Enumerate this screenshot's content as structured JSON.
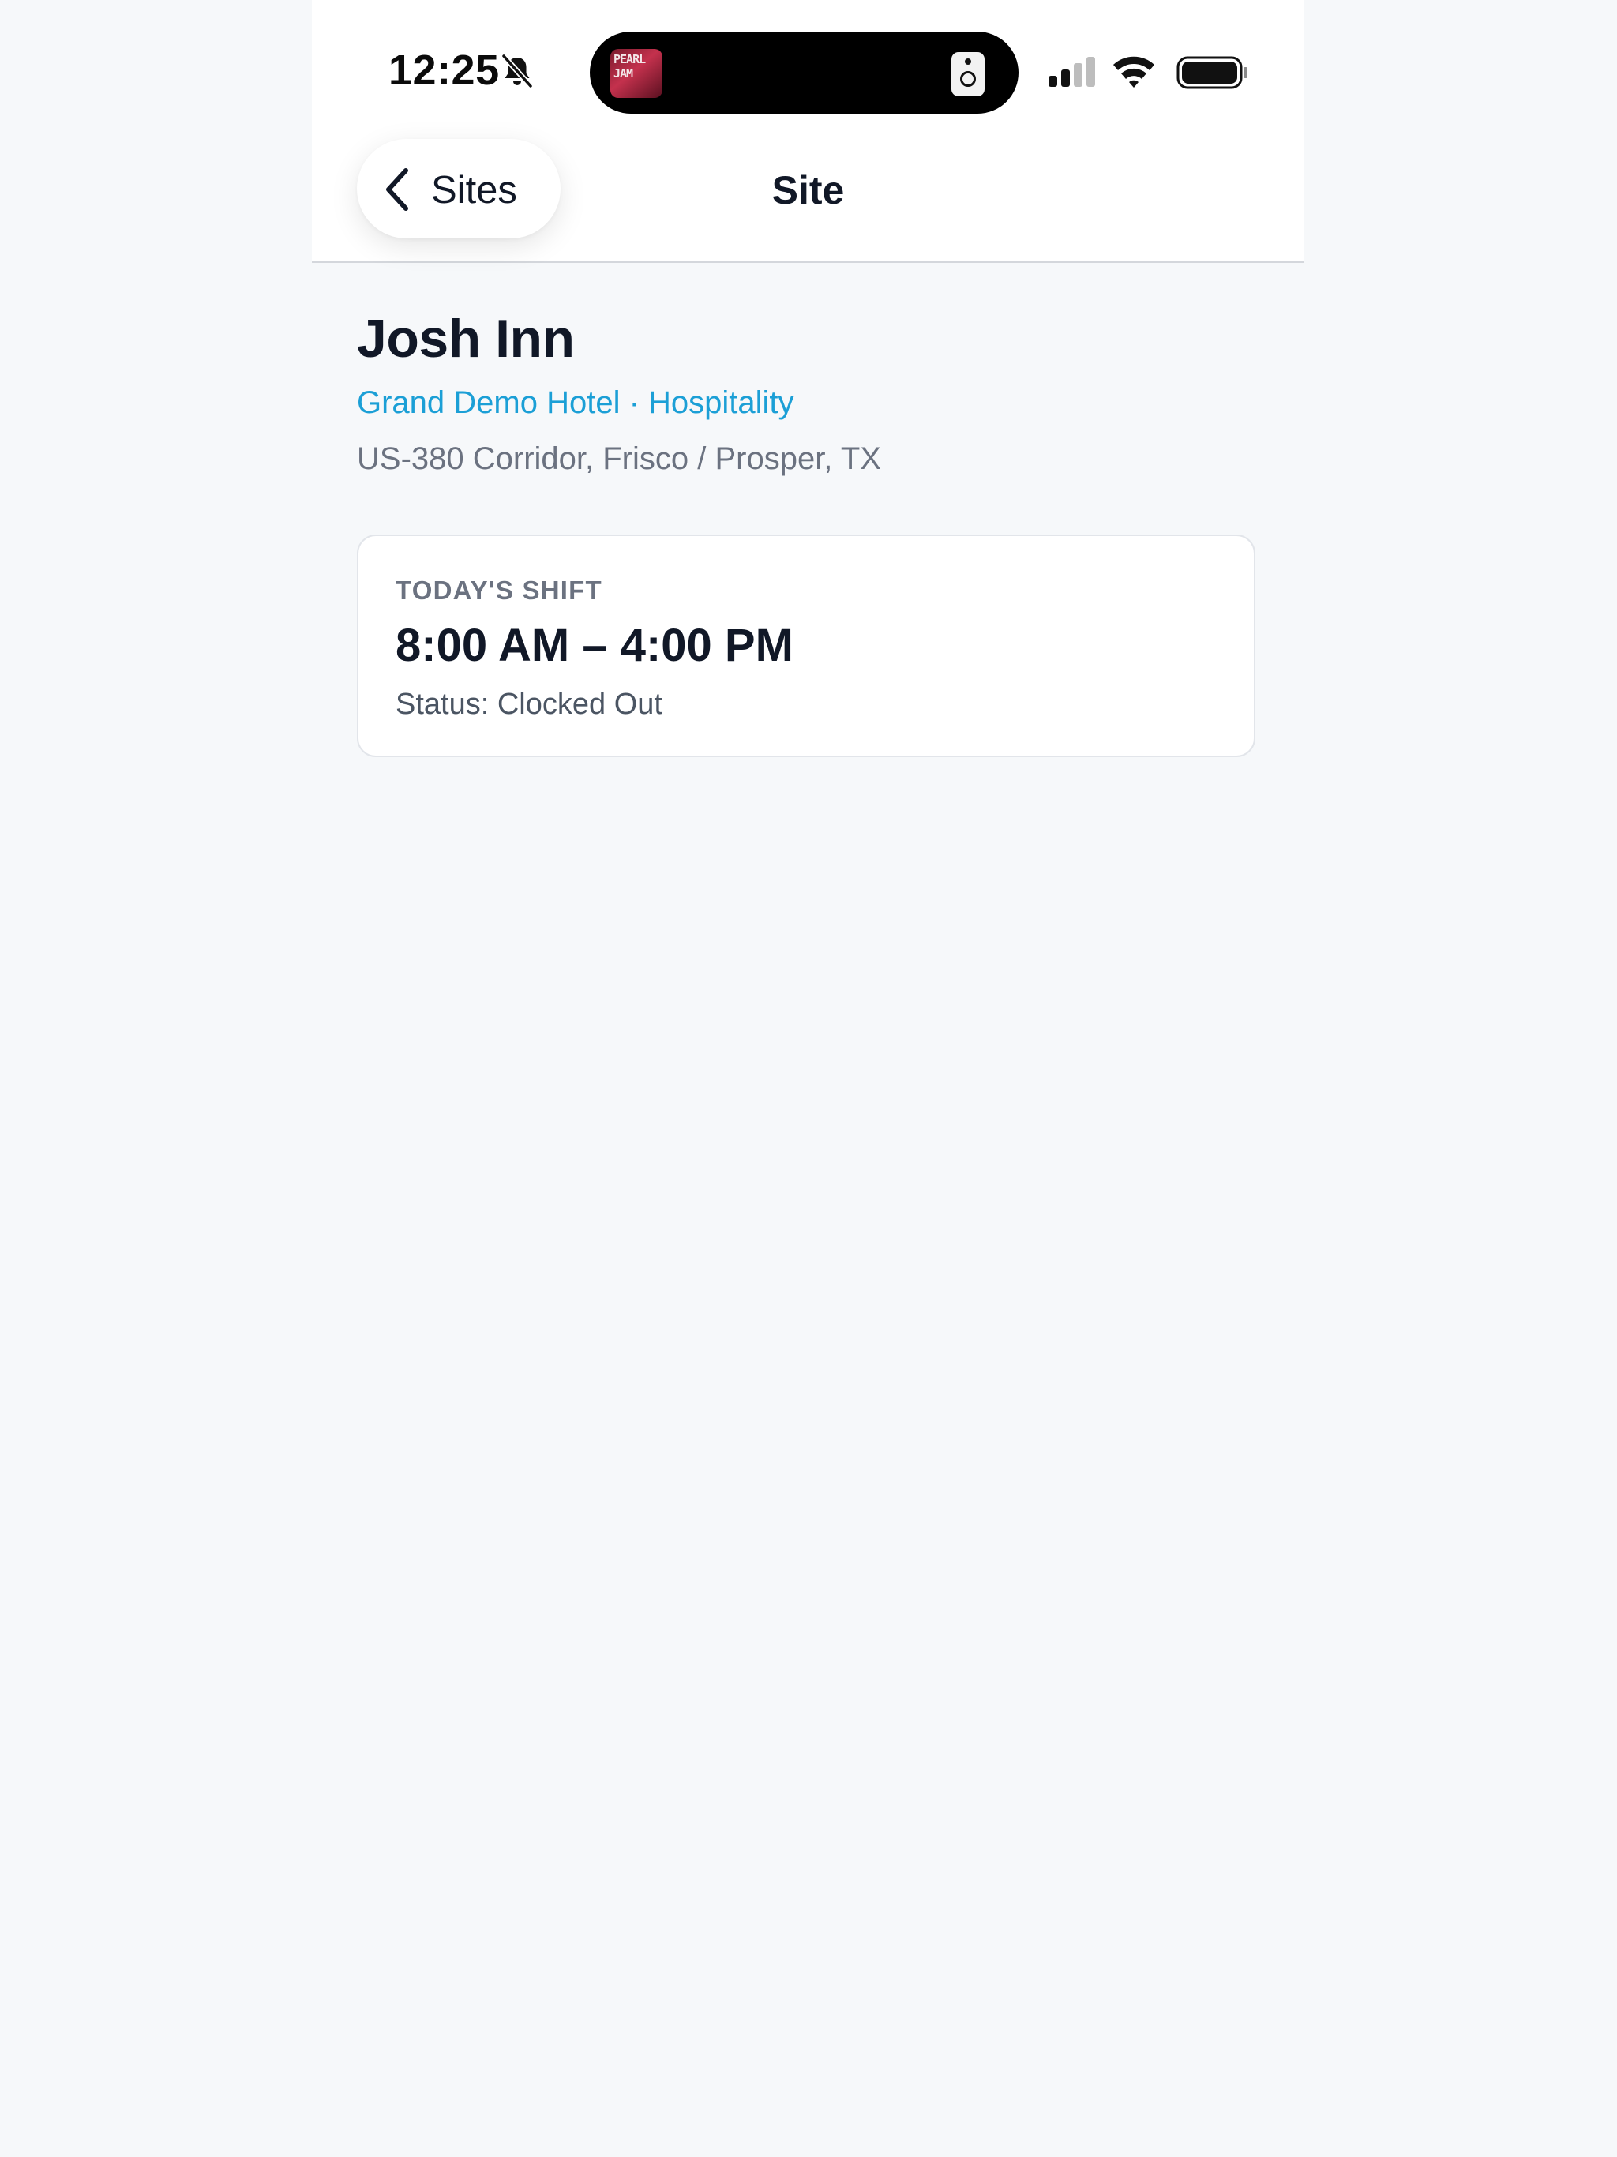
{
  "status_bar": {
    "time": "12:25",
    "icons": [
      "bell-slash-icon",
      "signal-icon",
      "wifi-icon",
      "battery-icon"
    ],
    "now_playing": {
      "album_art_text": "PEARL JAM",
      "icon": "speaker-icon"
    }
  },
  "nav": {
    "back_label": "Sites",
    "back_icon": "chevron-left-icon",
    "title": "Site"
  },
  "site": {
    "name": "Josh Inn",
    "org_line": "Grand Demo Hotel · Hospitality",
    "address": "US-380 Corridor, Frisco / Prosper, TX"
  },
  "shift": {
    "label": "TODAY'S SHIFT",
    "time_range": "8:00 AM – 4:00 PM",
    "status": "Status: Clocked Out"
  },
  "colors": {
    "accent": "#1b9fd6",
    "text_primary": "#111827",
    "text_secondary": "#6b7280",
    "background": "#f6f8fa",
    "card_border": "#e2e5ea"
  }
}
